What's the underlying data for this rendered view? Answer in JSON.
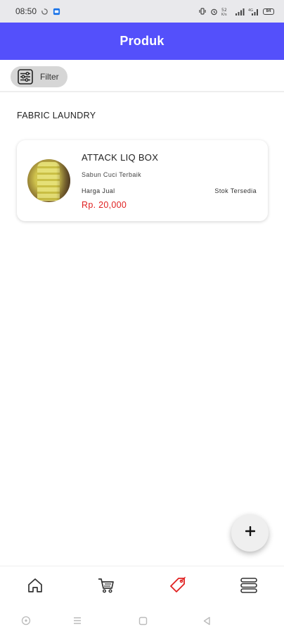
{
  "status_bar": {
    "time": "08:50",
    "battery": "84",
    "icons": [
      "sync-icon",
      "app-notification-icon",
      "vibrate-icon",
      "alarm-icon",
      "network-speed-icon",
      "signal-icon",
      "signal-2-icon",
      "battery-icon"
    ]
  },
  "app_bar": {
    "title": "Produk",
    "color": "#5450fb"
  },
  "filter": {
    "label": "Filter",
    "icon": "sliders-icon"
  },
  "section": {
    "title": "FABRIC LAUNDRY"
  },
  "products": [
    {
      "name": "ATTACK LIQ BOX",
      "description": "Sabun Cuci Terbaik",
      "price_label": "Harga Jual",
      "price": "Rp. 20,000",
      "stock_label": "Stok Tersedia",
      "image": "product-photo"
    }
  ],
  "fab": {
    "icon": "plus-icon"
  },
  "bottom_nav": {
    "active_color": "#e02020",
    "items": [
      {
        "name": "home",
        "icon": "home-icon",
        "active": false
      },
      {
        "name": "cart",
        "icon": "cart-icon",
        "active": false
      },
      {
        "name": "products",
        "icon": "tag-icon",
        "active": true
      },
      {
        "name": "menu",
        "icon": "stack-menu-icon",
        "active": false
      }
    ]
  },
  "system_nav": {
    "icons": [
      "assistant-icon",
      "recents-icon",
      "home-square-icon",
      "back-icon"
    ]
  }
}
